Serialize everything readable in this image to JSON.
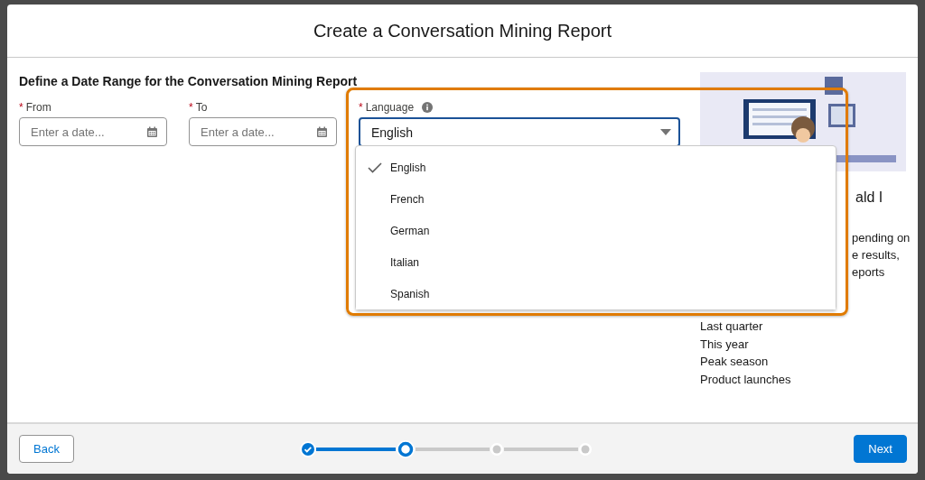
{
  "modal": {
    "title": "Create a Conversation Mining Report"
  },
  "section_title": "Define a Date Range for the Conversation Mining Report",
  "fields": [
    {
      "label": "From",
      "required_mark": "*",
      "placeholder": "Enter a date..."
    },
    {
      "label": "To",
      "required_mark": "*",
      "placeholder": "Enter a date..."
    }
  ],
  "language": {
    "label": "Language",
    "required_mark": "*",
    "value": "English",
    "expanded": true,
    "highlighted": true,
    "options": [
      {
        "label": "English",
        "selected": true
      },
      {
        "label": "French",
        "selected": false
      },
      {
        "label": "German",
        "selected": false
      },
      {
        "label": "Italian",
        "selected": false
      },
      {
        "label": "Spanish",
        "selected": false
      }
    ]
  },
  "help": {
    "heading_fragment": "ald I",
    "body_fragments": [
      "pending on",
      "e results,",
      "eports"
    ],
    "examples": [
      "Last quarter",
      "This year",
      "Peak season",
      "Product launches"
    ]
  },
  "footer": {
    "back": "Back",
    "next": "Next",
    "steps": [
      {
        "kind": "complete"
      },
      {
        "kind": "current"
      },
      {
        "kind": "incomplete"
      },
      {
        "kind": "incomplete"
      }
    ]
  }
}
